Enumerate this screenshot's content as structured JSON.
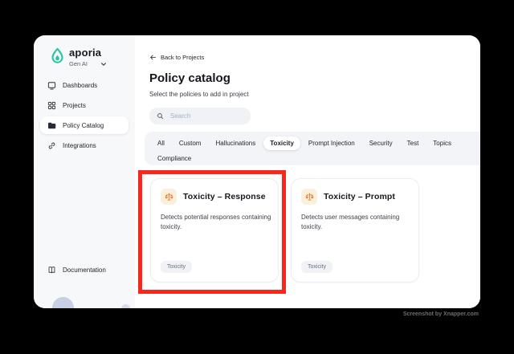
{
  "colors": {
    "brand_teal": "#25C4A4",
    "accent_orange": "#ED7014",
    "highlight_red": "#F5281B",
    "sidebar_bg": "#F7F8FA",
    "tabbar_bg": "#F3F4F8"
  },
  "sidebar": {
    "brand": "aporia",
    "workspace": "Gen AI",
    "items": [
      {
        "label": "Dashboards",
        "icon": "dashboard-icon",
        "active": false
      },
      {
        "label": "Projects",
        "icon": "grid-icon",
        "active": false
      },
      {
        "label": "Policy Catalog",
        "icon": "folder-icon",
        "active": true
      },
      {
        "label": "Integrations",
        "icon": "link-icon",
        "active": false
      }
    ],
    "footer": {
      "documentation_label": "Documentation"
    }
  },
  "main": {
    "back_link": "Back to Projects",
    "title": "Policy catalog",
    "subtitle": "Select the policies to add in project",
    "search": {
      "placeholder": "Search"
    },
    "tabs": [
      {
        "label": "All",
        "active": false
      },
      {
        "label": "Custom",
        "active": false
      },
      {
        "label": "Hallucinations",
        "active": false
      },
      {
        "label": "Toxicity",
        "active": true
      },
      {
        "label": "Prompt Injection",
        "active": false
      },
      {
        "label": "Security",
        "active": false
      },
      {
        "label": "Test",
        "active": false
      },
      {
        "label": "Topics",
        "active": false
      },
      {
        "label": "Compliance",
        "active": false
      }
    ],
    "cards": [
      {
        "title": "Toxicity – Response",
        "description": "Detects potential responses containing toxicity.",
        "tag": "Toxicity",
        "icon": "scales-icon",
        "highlighted": true
      },
      {
        "title": "Toxicity – Prompt",
        "description": "Detects user messages containing toxicity.",
        "tag": "Toxicity",
        "icon": "scales-icon",
        "highlighted": false
      }
    ]
  },
  "annotation": {
    "type": "highlight-box",
    "color": "#F5281B"
  },
  "watermark": "Screenshot by Xnapper.com"
}
